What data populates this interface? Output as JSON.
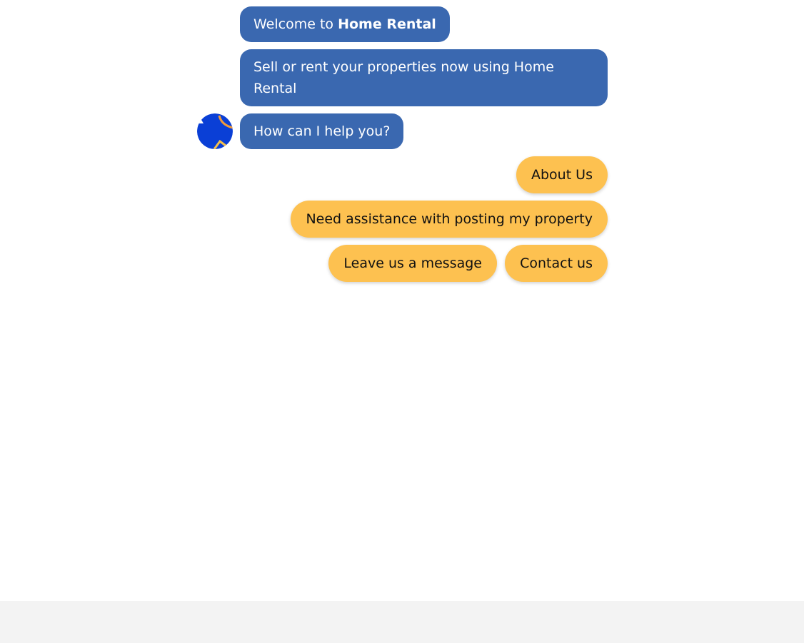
{
  "messages": {
    "welcome_prefix": "Welcome to ",
    "welcome_brand": "Home Rental",
    "intro": "Sell or rent your properties now using Home Rental",
    "help": "How can I help you?"
  },
  "quick_replies": {
    "about": "About Us",
    "posting": "Need assistance with posting my property",
    "message": "Leave us a message",
    "contact": "Contact us"
  },
  "colors": {
    "bot_bubble": "#3a68b0",
    "quick_reply": "#fdc150",
    "avatar_bg": "#0a3fd6",
    "composer_bg": "#f3f3f3"
  },
  "icons": {
    "avatar": "bot-avatar-icon"
  }
}
